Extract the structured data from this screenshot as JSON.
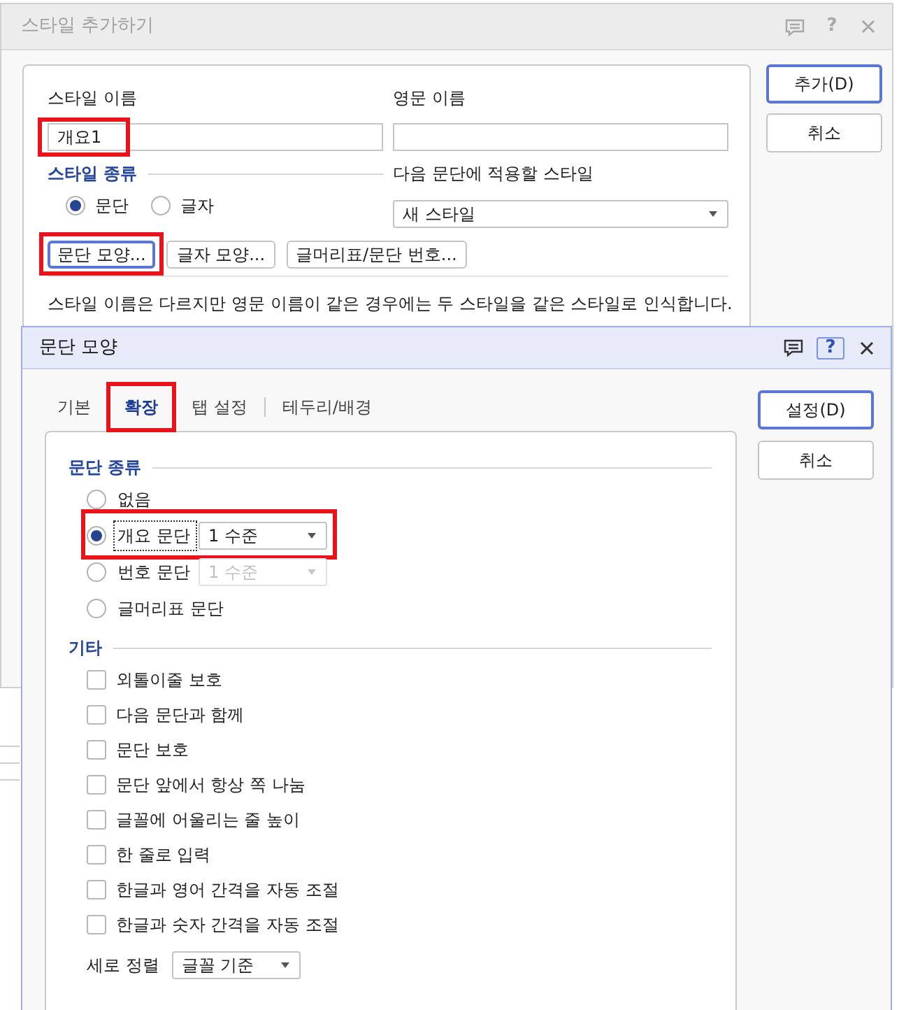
{
  "add_style_dialog": {
    "title": "스타일 추가하기",
    "active": false,
    "help_button": {
      "label": "?",
      "hovered": false
    },
    "style_name": {
      "label": "스타일 이름",
      "value": "개요1",
      "highlighted": true
    },
    "english_name": {
      "label": "영문 이름"
    },
    "style_type": {
      "heading": "스타일 종류",
      "options": [
        {
          "label": "문단",
          "selected": true
        },
        {
          "label": "글자",
          "selected": false
        }
      ]
    },
    "next_style": {
      "label": "다음 문단에 적용할 스타일",
      "value": "새 스타일"
    },
    "format_buttons": [
      {
        "label": "문단 모양...",
        "focused": true,
        "highlighted": true
      },
      {
        "label": "글자 모양...",
        "focused": false,
        "highlighted": false
      },
      {
        "label": "글머리표/문단 번호...",
        "focused": false,
        "highlighted": false
      }
    ],
    "note": "스타일 이름은 다르지만 영문 이름이 같은 경우에는 두 스타일을 같은 스타일로 인식합니다.",
    "buttons": [
      {
        "label": "추가(D)",
        "default": true
      },
      {
        "label": "취소",
        "default": false
      }
    ]
  },
  "paragraph_shape_dialog": {
    "title": "문단 모양",
    "active": true,
    "help_button": {
      "label": "?",
      "hovered": true
    },
    "tabs": [
      {
        "label": "기본",
        "selected": false,
        "highlighted": false
      },
      {
        "label": "확장",
        "selected": true,
        "highlighted": true
      },
      {
        "label": "탭 설정",
        "selected": false,
        "highlighted": false
      },
      {
        "label": "테두리/배경",
        "selected": false,
        "highlighted": false
      }
    ],
    "paragraph_type": {
      "heading": "문단 종류",
      "options": [
        {
          "kind": "plain",
          "label": "없음",
          "selected": false,
          "focused": false,
          "highlighted": false
        },
        {
          "kind": "level",
          "label": "개요 문단",
          "selected": true,
          "focused": true,
          "highlighted": true,
          "dropdown": {
            "value": "1 수준",
            "disabled": false
          }
        },
        {
          "kind": "level",
          "label": "번호 문단",
          "selected": false,
          "focused": false,
          "highlighted": false,
          "dropdown": {
            "value": "1 수준",
            "disabled": true
          }
        },
        {
          "kind": "plain",
          "label": "글머리표 문단",
          "selected": false,
          "focused": false,
          "highlighted": false
        }
      ]
    },
    "other": {
      "heading": "기타",
      "checkboxes": [
        {
          "label": "외톨이줄 보호",
          "checked": false
        },
        {
          "label": "다음 문단과 함께",
          "checked": false
        },
        {
          "label": "문단 보호",
          "checked": false
        },
        {
          "label": "문단 앞에서 항상 쪽 나눔",
          "checked": false
        },
        {
          "label": "글꼴에 어울리는 줄 높이",
          "checked": false
        },
        {
          "label": "한 줄로 입력",
          "checked": false
        },
        {
          "label": "한글과 영어 간격을 자동 조절",
          "checked": false
        },
        {
          "label": "한글과 숫자 간격을 자동 조절",
          "checked": false
        }
      ],
      "vertical_align": {
        "label": "세로 정렬",
        "value": "글꼴 기준"
      }
    },
    "buttons": [
      {
        "label": "설정(D)",
        "default": true
      },
      {
        "label": "취소",
        "default": false
      }
    ]
  }
}
